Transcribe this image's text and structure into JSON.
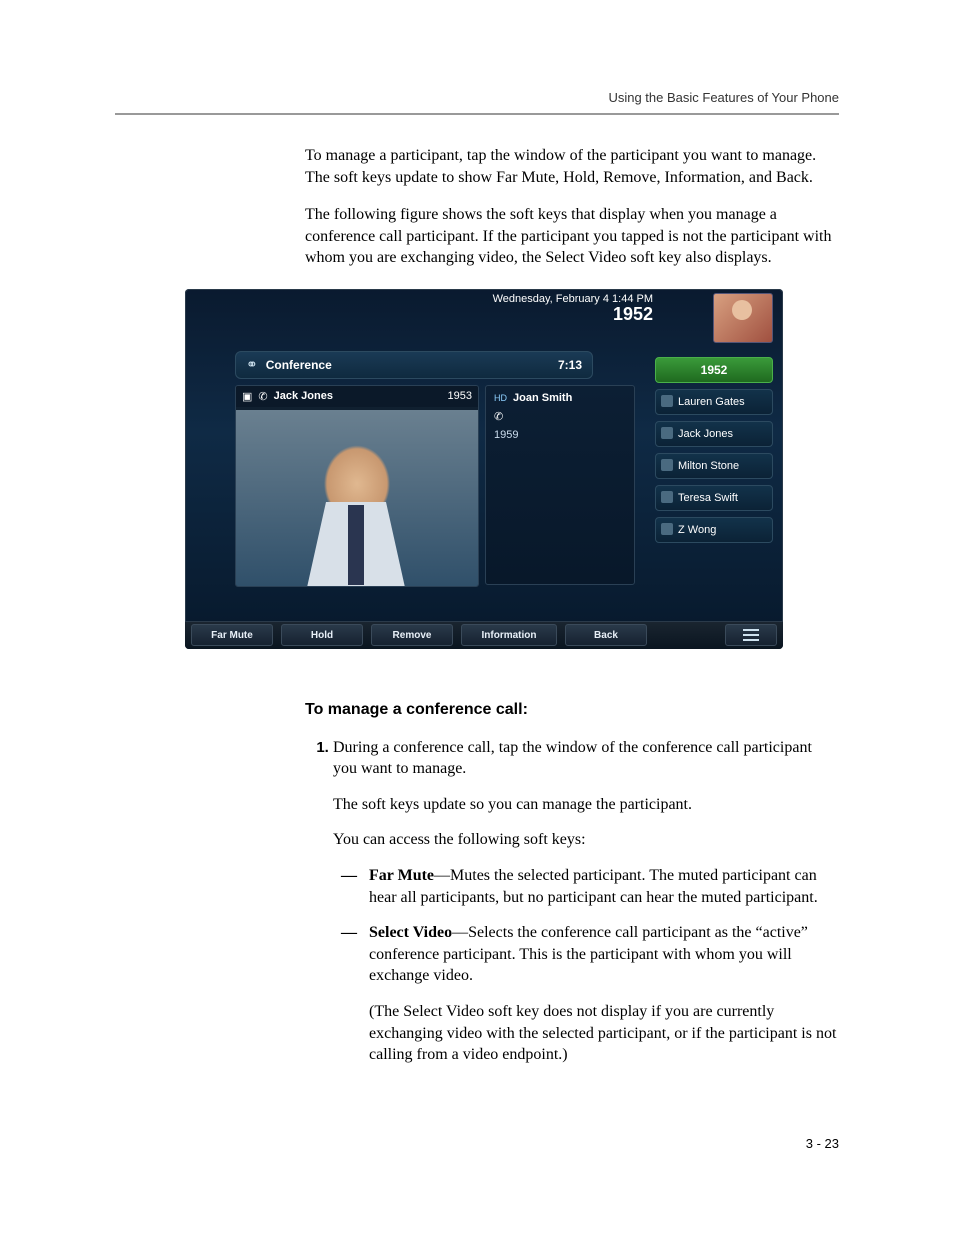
{
  "running_head": "Using the Basic Features of Your Phone",
  "intro_p1": "To manage a participant, tap the window of the participant you want to manage. The soft keys update to show Far Mute, Hold, Remove, Information, and Back.",
  "intro_p2": "The following figure shows the soft keys that display when you manage a conference call participant. If the participant you tapped is not the participant with whom you are exchanging video, the Select Video soft key also displays.",
  "phone": {
    "status_date": "Wednesday, February 4  1:44 PM",
    "status_ext": "1952",
    "conference_title": "Conference",
    "conference_time": "7:13",
    "main": {
      "name": "Jack Jones",
      "ext": "1953"
    },
    "secondary": {
      "hd": "HD",
      "name": "Joan Smith",
      "ext": "1959"
    },
    "sidebar": {
      "active_ext": "1952",
      "contacts": [
        "Lauren Gates",
        "Jack Jones",
        "Milton Stone",
        "Teresa Swift",
        "Z Wong"
      ]
    },
    "softkeys": [
      "Far Mute",
      "Hold",
      "Remove",
      "Information",
      "Back"
    ]
  },
  "subhead": "To manage a conference call:",
  "step1_a": "During a conference call, tap the window of the conference call participant you want to manage.",
  "step1_b": "The soft keys update so you can manage the participant.",
  "step1_c": "You can access the following soft keys:",
  "bullets": {
    "far_mute_label": "Far Mute",
    "far_mute_text": "—Mutes the selected participant. The muted participant can hear all participants, but no participant can hear the muted participant.",
    "select_video_label": "Select Video",
    "select_video_text": "—Selects the conference call participant as the “active” conference participant. This is the participant with whom you will exchange video.",
    "select_video_note": "(The Select Video soft key does not display if you are currently exchanging video with the selected participant, or if the participant is not calling from a video endpoint.)"
  },
  "page_number": "3 - 23"
}
